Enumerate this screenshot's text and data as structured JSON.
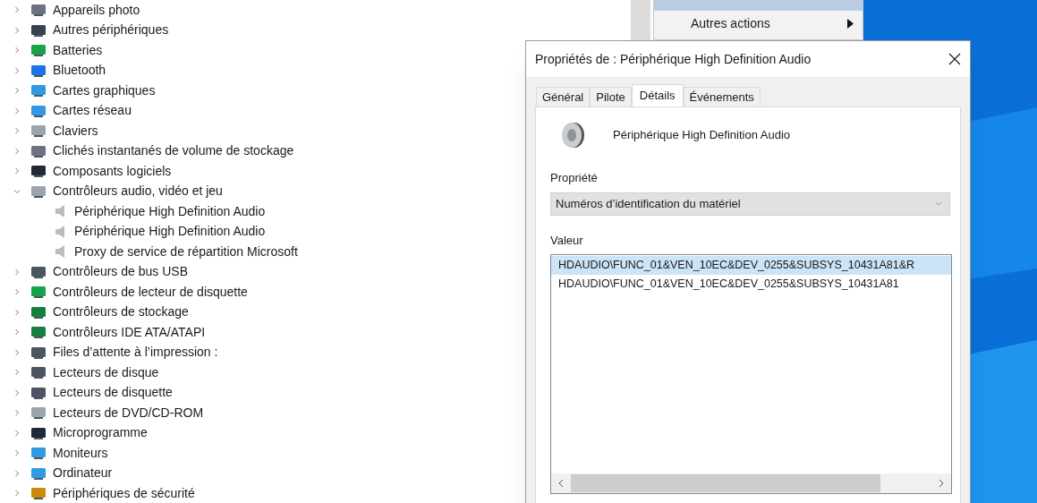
{
  "device_tree": {
    "items": [
      {
        "label": "Appareils photo",
        "expanded": false
      },
      {
        "label": "Autres périphériques",
        "expanded": false
      },
      {
        "label": "Batteries",
        "expanded": false
      },
      {
        "label": "Bluetooth",
        "expanded": false
      },
      {
        "label": "Cartes graphiques",
        "expanded": false
      },
      {
        "label": "Cartes réseau",
        "expanded": false
      },
      {
        "label": "Claviers",
        "expanded": false
      },
      {
        "label": "Clichés instantanés de volume de stockage",
        "expanded": false
      },
      {
        "label": "Composants logiciels",
        "expanded": false
      },
      {
        "label": "Contrôleurs audio, vidéo et jeu",
        "expanded": true,
        "children": [
          {
            "label": "Périphérique High Definition Audio"
          },
          {
            "label": "Périphérique High Definition Audio"
          },
          {
            "label": "Proxy de service de répartition Microsoft"
          }
        ]
      },
      {
        "label": "Contrôleurs de bus USB",
        "expanded": false
      },
      {
        "label": "Contrôleurs de lecteur de disquette",
        "expanded": false
      },
      {
        "label": "Contrôleurs de stockage",
        "expanded": false
      },
      {
        "label": "Contrôleurs IDE ATA/ATAPI",
        "expanded": false
      },
      {
        "label": "Files d’attente à l’impression :",
        "expanded": false
      },
      {
        "label": "Lecteurs de disque",
        "expanded": false
      },
      {
        "label": "Lecteurs de disquette",
        "expanded": false
      },
      {
        "label": "Lecteurs de DVD/CD-ROM",
        "expanded": false
      },
      {
        "label": "Microprogramme",
        "expanded": false
      },
      {
        "label": "Moniteurs",
        "expanded": false
      },
      {
        "label": "Ordinateur",
        "expanded": false
      },
      {
        "label": "Périphériques de sécurité",
        "expanded": false
      }
    ]
  },
  "context_menu": {
    "items": [
      {
        "label": "Autres actions",
        "submenu": true
      }
    ]
  },
  "dialog": {
    "title": "Propriétés de : Périphérique High Definition Audio",
    "tabs": [
      {
        "label": "Général",
        "selected": false
      },
      {
        "label": "Pilote",
        "selected": false
      },
      {
        "label": "Détails",
        "selected": true
      },
      {
        "label": "Événements",
        "selected": false
      }
    ],
    "device_name": "Périphérique High Definition Audio",
    "property_label": "Propriété",
    "property_value": "Numéros d’identification du matériel",
    "value_label": "Valeur",
    "values": [
      {
        "text": "HDAUDIO\\FUNC_01&VEN_10EC&DEV_0255&SUBSYS_10431A81&R",
        "selected": true
      },
      {
        "text": "HDAUDIO\\FUNC_01&VEN_10EC&DEV_0255&SUBSYS_10431A81",
        "selected": false
      }
    ]
  }
}
